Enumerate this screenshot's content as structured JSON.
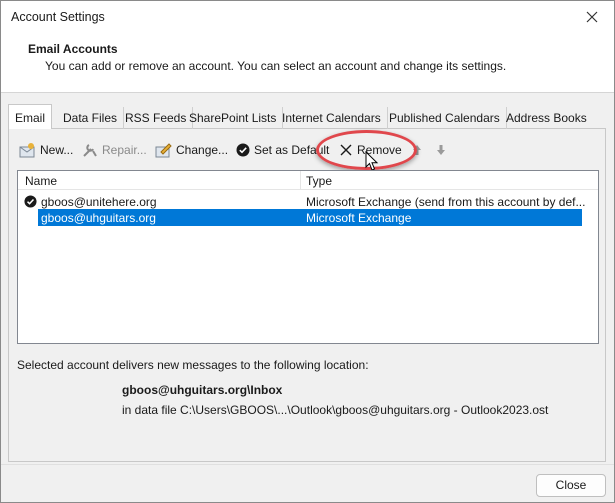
{
  "window": {
    "title": "Account Settings"
  },
  "header": {
    "title": "Email Accounts",
    "subtitle": "You can add or remove an account. You can select an account and change its settings."
  },
  "tabs": [
    {
      "label": "Email",
      "active": true
    },
    {
      "label": "Data Files"
    },
    {
      "label": "RSS Feeds"
    },
    {
      "label": "SharePoint Lists"
    },
    {
      "label": "Internet Calendars"
    },
    {
      "label": "Published Calendars"
    },
    {
      "label": "Address Books"
    }
  ],
  "toolbar": {
    "new_label": "New...",
    "repair_label": "Repair...",
    "change_label": "Change...",
    "set_default_label": "Set as Default",
    "remove_label": "Remove"
  },
  "list": {
    "col_name": "Name",
    "col_type": "Type",
    "rows": [
      {
        "name": "gboos@unitehere.org",
        "type": "Microsoft Exchange (send from this account by def...",
        "default": true
      },
      {
        "name": "gboos@uhguitars.org",
        "type": "Microsoft Exchange",
        "selected": true
      }
    ]
  },
  "location": {
    "heading": "Selected account delivers new messages to the following location:",
    "mailbox": "gboos@uhguitars.org\\Inbox",
    "file": "in data file C:\\Users\\GBOOS\\...\\Outlook\\gboos@uhguitars.org - Outlook2023.ost"
  },
  "footer": {
    "close_label": "Close"
  },
  "colors": {
    "selection": "#0078d7",
    "highlight_ring": "#e0474c"
  }
}
